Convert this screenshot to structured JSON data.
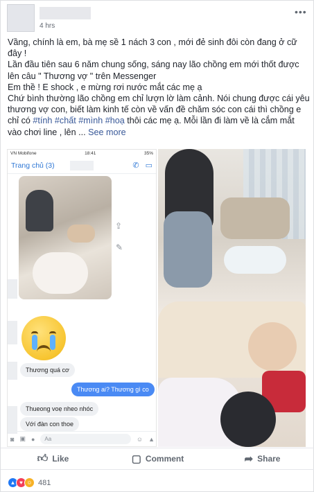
{
  "post": {
    "time": "4 hrs",
    "more_icon": "•••",
    "lines": [
      "Vầng, chính là em, bà mẹ sề 1 nách 3 con , mới đẻ sinh đôi còn đang ở cữ đây !",
      "Lần đầu tiên sau 6 năm chung sống, sáng nay lão chồng em mới thốt được lên câu \" Thương vợ \" trên Messenger",
      "Em thề ! E shock , e mừng rơi nước mắt các mẹ ạ",
      "Chứ bình thường lão chồng em chỉ lượn lờ làm cảnh. Nói chung được cái yêu thương vợ con, biết làm kinh tế còn về vấn đề chăm sóc con cái thì chồng e chỉ có"
    ],
    "hashtags": [
      "#tính",
      "#chất",
      "#mình",
      "#hoạ"
    ],
    "tail_text": "thôi các mẹ ạ. Mỗi lần đi làm về là cắm mắt vào chơi line , lên ...",
    "see_more": "See more"
  },
  "phone": {
    "status_left": "VN Mobifone",
    "status_center": "18:41",
    "status_right": "35%",
    "back_label": "Trang chủ (3)",
    "messages": [
      {
        "dir": "in",
        "text": "Thương quá cơ"
      },
      {
        "dir": "out",
        "text": "Thương ai? Thương gì co"
      },
      {
        "dir": "in",
        "text": "Thueong voẹ nheo nhóc"
      },
      {
        "dir": "in",
        "text": "Vớí đàn con thoe"
      }
    ],
    "composer_placeholder": "Aa"
  },
  "actions": {
    "like": "Like",
    "comment": "Comment",
    "share": "Share"
  },
  "reactions": {
    "count": "481"
  },
  "colors": {
    "link": "#385898",
    "messenger_blue": "#4a8af4",
    "action_gray": "#606770"
  }
}
